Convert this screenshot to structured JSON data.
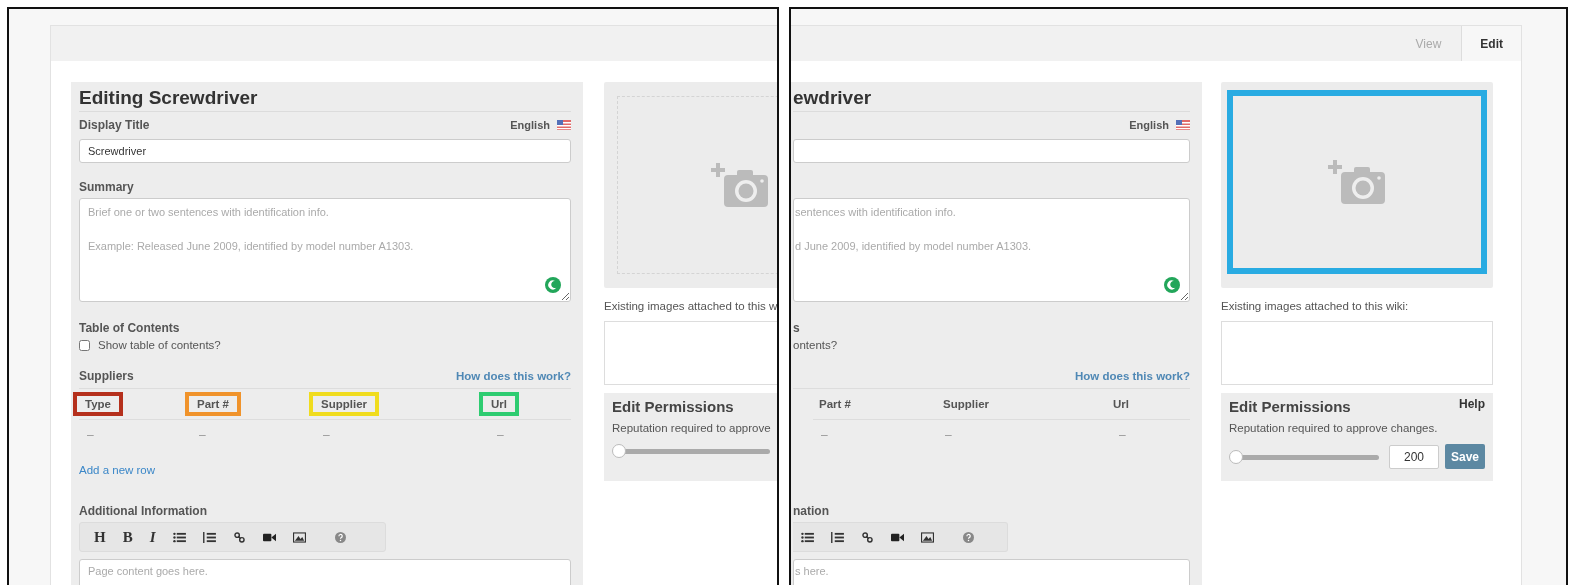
{
  "panels": [
    {
      "kind": "full",
      "form": {
        "title": "Editing Screwdriver",
        "display_title_label": "Display Title",
        "language": "English",
        "display_title_value": "Screwdriver",
        "summary_label": "Summary",
        "summary_placeholder": "Brief one or two sentences with identification info.\n\nExample: Released June 2009, identified by model number A1303.",
        "toc_label": "Table of Contents",
        "toc_checkbox": {
          "label": "Show table of contents?",
          "checked": false
        },
        "suppliers_label": "Suppliers",
        "help_link": "How does this work?",
        "columns": [
          {
            "label": "Type",
            "color": "#b5301c"
          },
          {
            "label": "Part #",
            "color": "#f0932b"
          },
          {
            "label": "Supplier",
            "color": "#f0dc1e"
          },
          {
            "label": "Url",
            "color": "#2ecc71"
          }
        ],
        "rows": [
          [
            "–",
            "–",
            "–",
            "–"
          ]
        ],
        "add_row_link": "Add a new row",
        "additional_label": "Additional Information",
        "toolbar": [
          {
            "kind": "text",
            "label": "H"
          },
          {
            "kind": "text",
            "label": "B"
          },
          {
            "kind": "text",
            "label": "I"
          },
          {
            "kind": "bullet-list"
          },
          {
            "kind": "numbered-list"
          },
          {
            "kind": "link"
          },
          {
            "kind": "video"
          },
          {
            "kind": "image"
          },
          {
            "kind": "help"
          }
        ],
        "content_placeholder": "Page content goes here."
      },
      "sidebar": {
        "photo_highlighted": false,
        "existing_images_label": "Existing images attached to this w",
        "permissions_title": "Edit Permissions",
        "reputation_text": "Reputation required to approve",
        "slider": {
          "level": 0
        }
      }
    },
    {
      "kind": "cropped",
      "tabs": [
        {
          "label": "View",
          "selected": false
        },
        {
          "label": "Edit",
          "selected": true
        }
      ],
      "form": {
        "title": "ewdriver",
        "language": "English",
        "summary_placeholder": "sentences with identification info.\n\nd June 2009, identified by model number A1303.",
        "toc_label": "s",
        "toc_checkbox": {
          "label": "ontents?"
        },
        "help_link": "How does this work?",
        "columns": [
          {
            "label": "Part #"
          },
          {
            "label": "Supplier"
          },
          {
            "label": "Url"
          }
        ],
        "rows": [
          [
            "–",
            "–",
            "–"
          ]
        ],
        "additional_label": "nation",
        "toolbar": [
          {
            "kind": "bullet-list"
          },
          {
            "kind": "numbered-list"
          },
          {
            "kind": "link"
          },
          {
            "kind": "video"
          },
          {
            "kind": "image"
          },
          {
            "kind": "help"
          }
        ],
        "content_placeholder": "s here."
      },
      "sidebar": {
        "photo_highlighted": true,
        "existing_images_label": "Existing images attached to this wiki:",
        "permissions_title": "Edit Permissions",
        "help": "Help",
        "reputation_text": "Reputation required to approve changes.",
        "slider": {
          "level": 0
        },
        "value": "200",
        "save": "Save"
      }
    }
  ]
}
